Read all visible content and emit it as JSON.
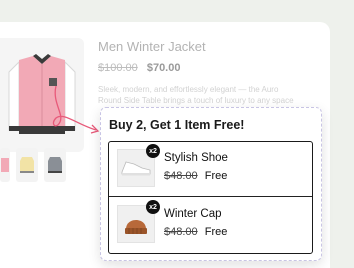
{
  "product": {
    "title": "Men Winter Jacket",
    "price_old": "$100.00",
    "price_new": "$70.00",
    "description": [
      "Sleek, modern, and effortlessly elegant — the Auro",
      "Round Side Table brings a touch of luxury to any space"
    ]
  },
  "offer": {
    "title": "Buy 2, Get 1 Item Free!",
    "items": [
      {
        "name": "Stylish Shoe",
        "qty": "x2",
        "price_old": "$48.00",
        "price_new": "Free",
        "icon": "sneaker-icon"
      },
      {
        "name": "Winter Cap",
        "qty": "x2",
        "price_old": "$48.00",
        "price_new": "Free",
        "icon": "beanie-icon"
      }
    ]
  },
  "colors": {
    "background": "#eef1ec",
    "jacket_body": "#f2a9b6",
    "jacket_sleeves": "#ffffff",
    "arrow": "#e85a7a",
    "panel_border": "#c8c4e4"
  }
}
